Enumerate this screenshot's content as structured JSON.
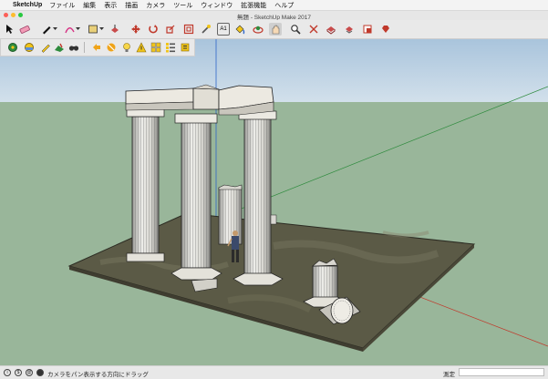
{
  "menubar": {
    "app_name": "SketchUp",
    "items": [
      "ファイル",
      "編集",
      "表示",
      "描画",
      "カメラ",
      "ツール",
      "ウィンドウ",
      "拡張機能",
      "ヘルプ"
    ]
  },
  "window": {
    "title": "無題 - SketchUp Make 2017",
    "traffic_lights": [
      "#fc5f57",
      "#fdbc2e",
      "#28c840"
    ]
  },
  "toolbar1": {
    "tools": [
      "select-icon",
      "eraser-icon",
      "pencil-icon",
      "arc-icon",
      "rectangle-icon",
      "push-pull-icon",
      "move-icon",
      "rotate-icon",
      "scale-icon",
      "offset-icon",
      "tape-measure-icon",
      "text-icon",
      "paint-bucket-icon",
      "orbit-icon",
      "pan-icon",
      "zoom-icon",
      "zoom-extents-icon",
      "warehouse-icon",
      "extension-warehouse-icon",
      "layout-icon",
      "ruby-icon"
    ]
  },
  "toolbar2": {
    "tools": [
      "geo-location-icon",
      "add-location-icon",
      "sandbox-smoove-icon",
      "sandbox-drape-icon",
      "walk-icon",
      "section-plane-icon",
      "shadows-icon",
      "lightbulb-icon",
      "warning-icon",
      "components-icon",
      "outliner-icon",
      "instructor-icon"
    ]
  },
  "statusbar": {
    "text": "カメラをパン表示する方向にドラッグ",
    "measure_label": "測定",
    "measure_value": ""
  },
  "colors": {
    "sky": "#bed4e6",
    "ground": "#99b69a",
    "terrain": "#5b5a46",
    "stone": "#e7e4dc",
    "accent_blue": "#2d65c8",
    "axis_red": "#c0392b",
    "axis_green": "#2e8b3d"
  }
}
